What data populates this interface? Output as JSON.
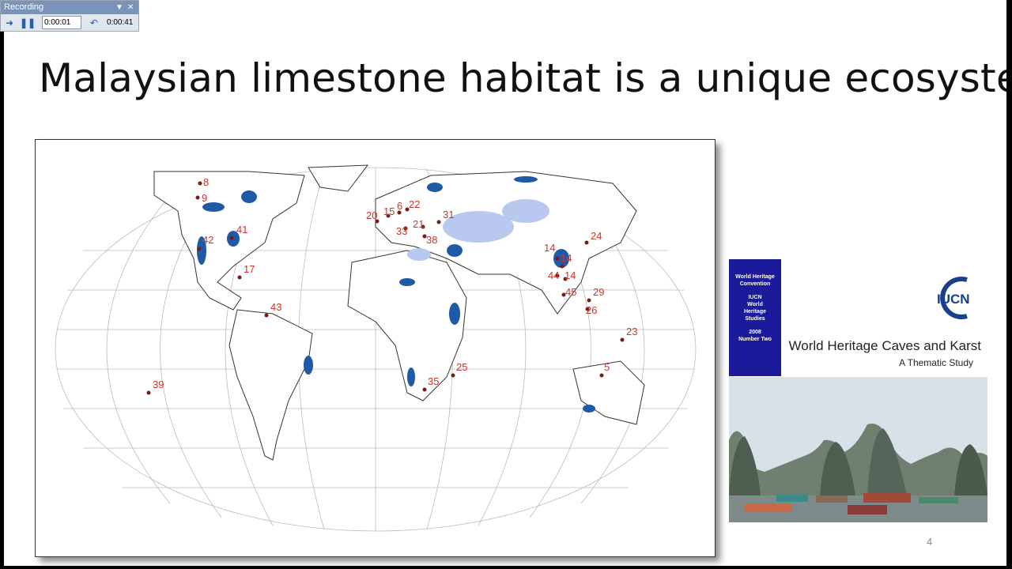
{
  "recorder": {
    "title": "Recording",
    "elapsed": "0:00:01",
    "total": "0:00:41",
    "forward_icon": "arrow-right-icon",
    "pause_icon": "pause-icon",
    "undo_icon": "undo-icon"
  },
  "slide": {
    "title": "Malaysian limestone habitat is a unique ecosystem",
    "page_number": "4"
  },
  "map": {
    "site_labels": [
      "8",
      "9",
      "42",
      "41",
      "17",
      "43",
      "39",
      "20",
      "15",
      "6",
      "22",
      "31",
      "33",
      "21",
      "38",
      "24",
      "14",
      "14",
      "44",
      "14",
      "45",
      "29",
      "26",
      "23",
      "5",
      "25",
      "35"
    ],
    "colors": {
      "karst": "#1f5aa6",
      "light_karst": "#b8c8ee",
      "site": "#d0342c"
    }
  },
  "book": {
    "strip_lines": [
      "World Heritage",
      "Convention",
      "",
      "IUCN",
      "World",
      "Heritage",
      "Studies",
      "",
      "2008",
      "Number Two"
    ],
    "logo_text": "IUCN",
    "title": "World Heritage Caves and Karst",
    "subtitle": "A Thematic Study",
    "strip_color": "#1a1a9a"
  }
}
